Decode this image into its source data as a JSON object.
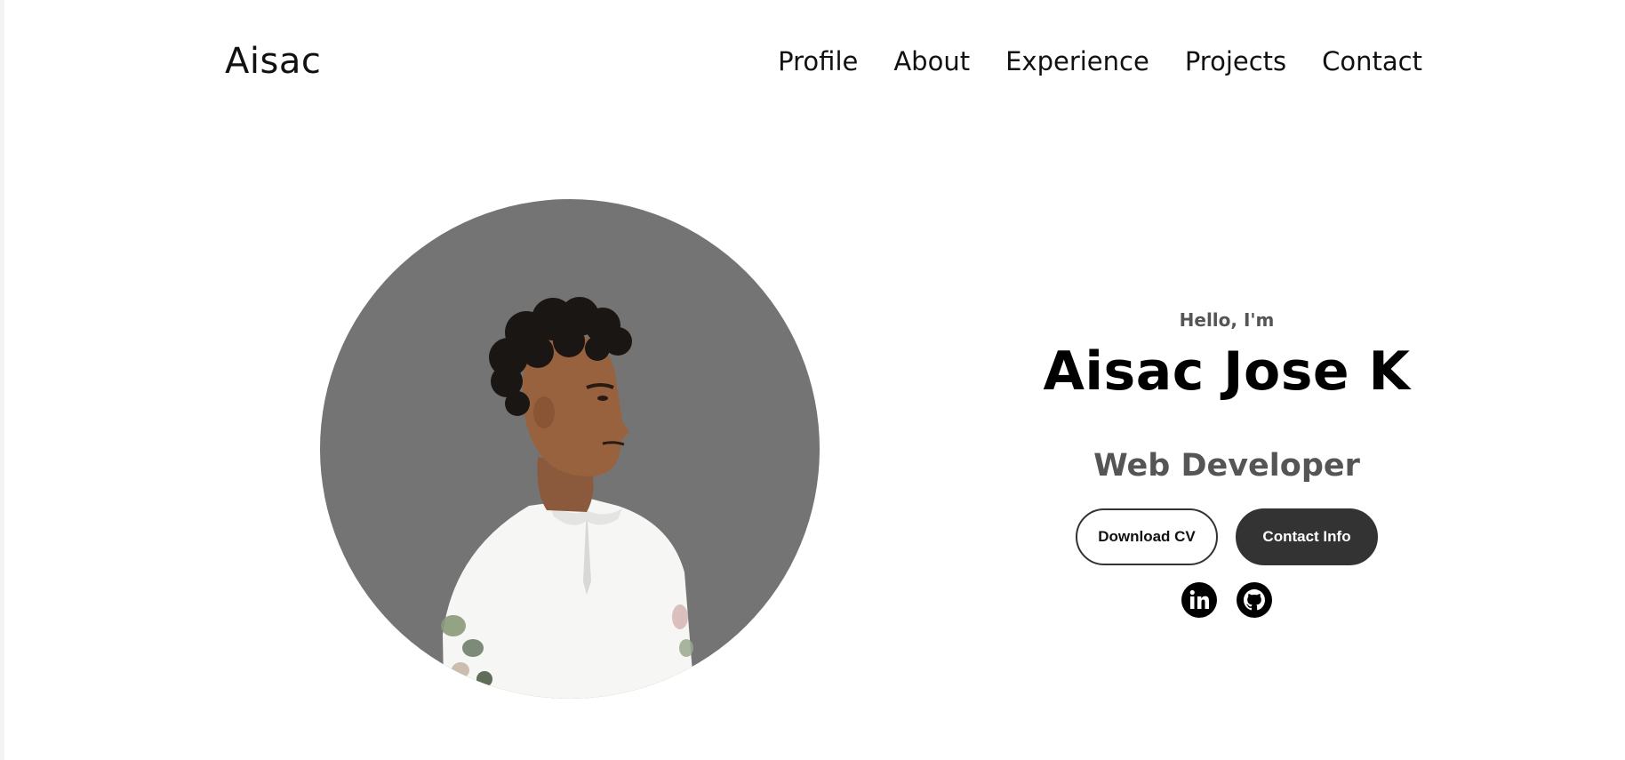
{
  "nav": {
    "logo": "Aisac",
    "links": [
      "Profile",
      "About",
      "Experience",
      "Projects",
      "Contact"
    ]
  },
  "profile": {
    "greeting": "Hello, I'm",
    "name": "Aisac Jose K",
    "title": "Web Developer",
    "buttons": {
      "download_cv": "Download CV",
      "contact_info": "Contact Info"
    },
    "socials": {
      "linkedin_icon": "linkedin-icon",
      "github_icon": "github-icon"
    }
  },
  "colors": {
    "circle_bg": "#747474",
    "button_dark": "#333333",
    "subtitle_gray": "#555555"
  }
}
